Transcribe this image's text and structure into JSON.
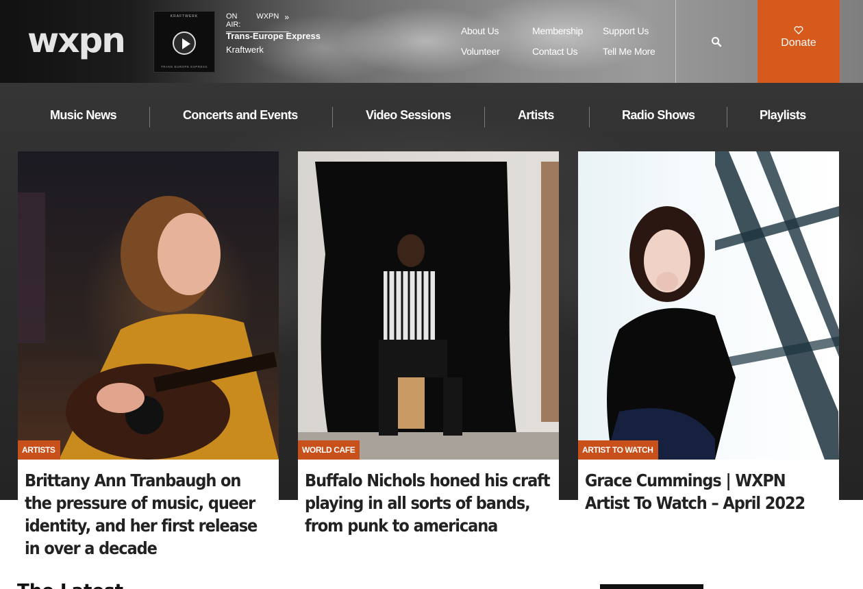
{
  "header": {
    "logo": "wxpn",
    "album_top_text": "KRAFTWERK",
    "album_bottom_text": "TRANS EUROPE EXPRESS",
    "on_air_label": "ON AIR:",
    "station": "WXPN",
    "track_title": "Trans-Europe Express",
    "track_artist": "Kraftwerk",
    "utility_links": [
      "About Us",
      "Membership",
      "Support Us",
      "Volunteer",
      "Contact Us",
      "Tell Me More"
    ],
    "search_icon": "search-icon",
    "donate_label": "Donate",
    "donate_color": "#d65a1c"
  },
  "nav": {
    "items": [
      "Music News",
      "Concerts and Events",
      "Video Sessions",
      "Artists",
      "Radio Shows",
      "Playlists"
    ]
  },
  "cards": [
    {
      "tag": "ARTISTS",
      "title": "Brittany Ann Tranbaugh on the pressure of music, queer identity, and her first release in over a decade"
    },
    {
      "tag": "WORLD CAFE",
      "title": "Buffalo Nichols honed his craft playing in all sorts of bands, from punk to americana"
    },
    {
      "tag": "ARTIST TO WATCH",
      "title": "Grace Cummings | WXPN Artist To Watch – April 2022"
    }
  ],
  "section": {
    "heading_partial": "The Latest"
  },
  "colors": {
    "accent": "#d65a1c",
    "tag": "#c8501b"
  }
}
